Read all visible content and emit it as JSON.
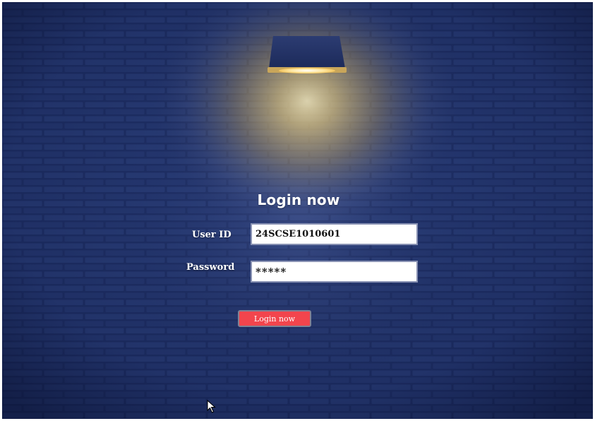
{
  "login": {
    "title": "Login now",
    "user_id_label": "User ID",
    "user_id_value": "24SCSE1010601",
    "password_label": "Password",
    "password_value": "*****",
    "submit_label": "Login now"
  },
  "scene": {
    "background_icon": "brick-wall",
    "lamp_icon": "wall-lamp-icon",
    "cursor_icon": "arrow-cursor-icon"
  },
  "colors": {
    "wall": "#142150",
    "button": "#f2454d",
    "field_border": "#8a93b4",
    "text": "#ffffff"
  }
}
